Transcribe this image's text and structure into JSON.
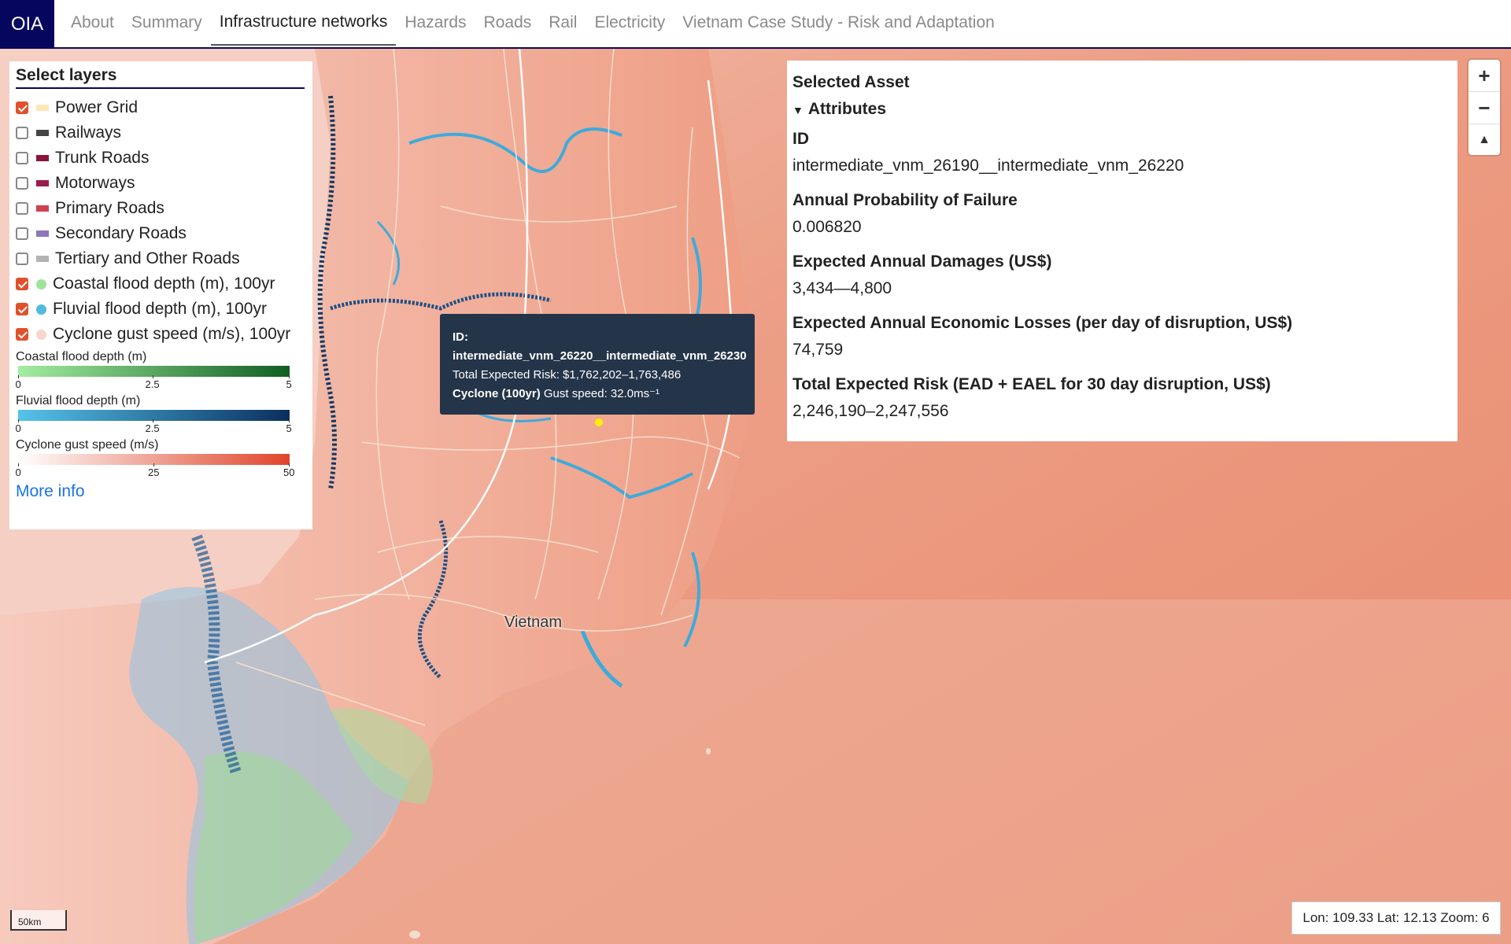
{
  "nav": {
    "logo": "OIA",
    "items": [
      {
        "label": "About",
        "active": false
      },
      {
        "label": "Summary",
        "active": false
      },
      {
        "label": "Infrastructure networks",
        "active": true
      },
      {
        "label": "Hazards",
        "active": false
      },
      {
        "label": "Roads",
        "active": false
      },
      {
        "label": "Rail",
        "active": false
      },
      {
        "label": "Electricity",
        "active": false
      },
      {
        "label": "Vietnam Case Study - Risk and Adaptation",
        "active": false
      }
    ]
  },
  "layers": {
    "title": "Select layers",
    "items": [
      {
        "label": "Power Grid",
        "checked": true,
        "color": "#fde8b5",
        "kind": "line"
      },
      {
        "label": "Railways",
        "checked": false,
        "color": "#444444",
        "kind": "line"
      },
      {
        "label": "Trunk Roads",
        "checked": false,
        "color": "#8a1538",
        "kind": "line"
      },
      {
        "label": "Motorways",
        "checked": false,
        "color": "#9b1b4b",
        "kind": "line"
      },
      {
        "label": "Primary Roads",
        "checked": false,
        "color": "#d0404f",
        "kind": "line"
      },
      {
        "label": "Secondary Roads",
        "checked": false,
        "color": "#8e77b5",
        "kind": "line"
      },
      {
        "label": "Tertiary and Other Roads",
        "checked": false,
        "color": "#b3b3b3",
        "kind": "line"
      },
      {
        "label": "Coastal flood depth (m), 100yr",
        "checked": true,
        "color": "#9de39a",
        "kind": "dot"
      },
      {
        "label": "Fluvial flood depth (m), 100yr",
        "checked": true,
        "color": "#52b9e0",
        "kind": "dot"
      },
      {
        "label": "Cyclone gust speed (m/s), 100yr",
        "checked": true,
        "color": "#f8d6cc",
        "kind": "dot"
      }
    ],
    "legends": [
      {
        "title": "Coastal flood depth (m)",
        "from": "#a3eda0",
        "to": "#0f5f23",
        "ticks": [
          "0",
          "2.5",
          "5"
        ]
      },
      {
        "title": "Fluvial flood depth (m)",
        "from": "#55c3ea",
        "to": "#0a2f5e",
        "ticks": [
          "0",
          "2.5",
          "5"
        ]
      },
      {
        "title": "Cyclone gust speed (m/s)",
        "from": "#ffffff",
        "to": "#e0452a",
        "ticks": [
          "0",
          "25",
          "50"
        ]
      }
    ],
    "more_info": "More info"
  },
  "asset": {
    "title": "Selected Asset",
    "section": "Attributes",
    "fields": [
      {
        "key": "ID",
        "value": "intermediate_vnm_26190__intermediate_vnm_26220"
      },
      {
        "key": "Annual Probability of Failure",
        "value": "0.006820"
      },
      {
        "key": "Expected Annual Damages (US$)",
        "value": "3,434—4,800"
      },
      {
        "key": "Expected Annual Economic Losses (per day of disruption, US$)",
        "value": "74,759"
      },
      {
        "key": "Total Expected Risk (EAD + EAEL for 30 day disruption, US$)",
        "value": "2,246,190–2,247,556"
      }
    ]
  },
  "zoom": {
    "in": "+",
    "out": "−",
    "compass": "▲"
  },
  "tooltip": {
    "id_label": "ID:",
    "id_value": "intermediate_vnm_26220__intermediate_vnm_26230",
    "risk_text": "Total Expected Risk: $1,762,202–1,763,486",
    "hazard_label": "Cyclone (100yr)",
    "hazard_text": " Gust speed: 32.0ms⁻¹"
  },
  "map": {
    "country_label": "Vietnam",
    "scale": "50km"
  },
  "coords": "Lon: 109.33 Lat: 12.13 Zoom: 6"
}
